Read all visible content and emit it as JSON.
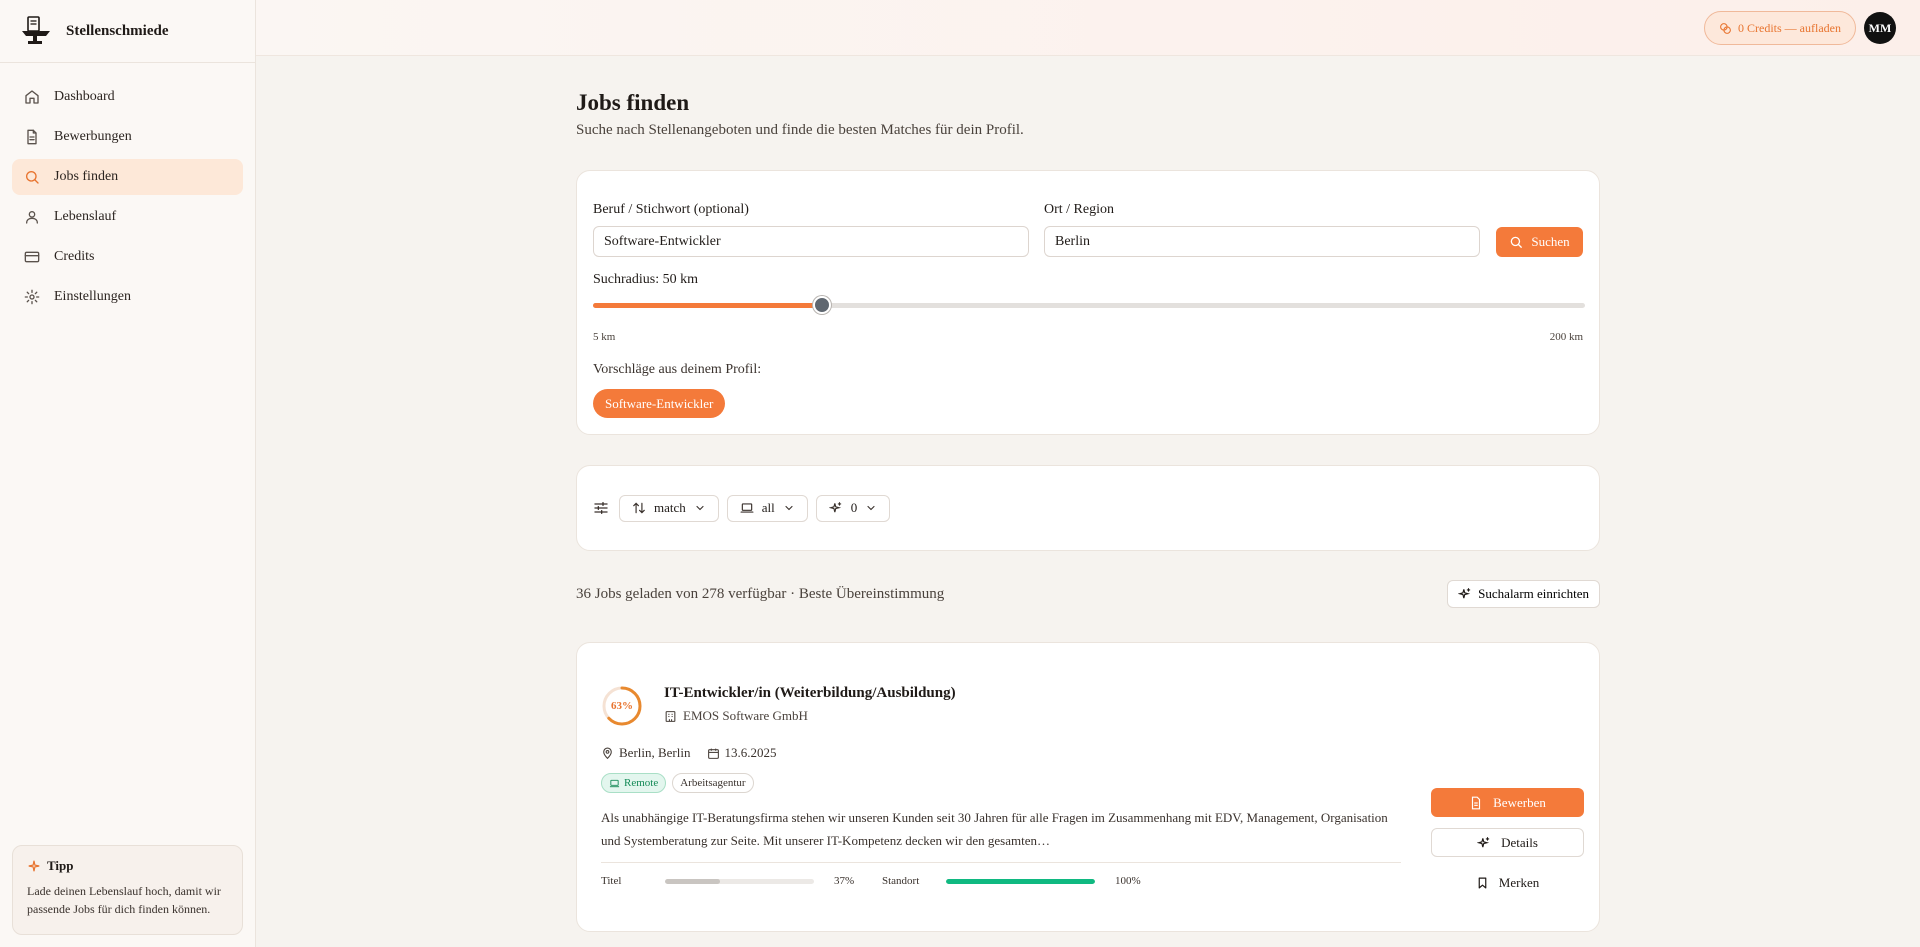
{
  "app": {
    "name": "Stellenschmiede"
  },
  "sidebar": {
    "items": [
      {
        "label": "Dashboard",
        "icon": "home-icon"
      },
      {
        "label": "Bewerbungen",
        "icon": "document-icon"
      },
      {
        "label": "Jobs finden",
        "icon": "search-icon",
        "active": true
      },
      {
        "label": "Lebenslauf",
        "icon": "user-icon"
      },
      {
        "label": "Credits",
        "icon": "credit-card-icon"
      },
      {
        "label": "Einstellungen",
        "icon": "gear-icon"
      }
    ],
    "tip": {
      "title": "Tipp",
      "text": "Lade deinen Lebenslauf hoch, damit wir passende Jobs für dich finden können."
    }
  },
  "topbar": {
    "credits_label": "0 Credits — aufladen",
    "avatar_initials": "MM"
  },
  "page": {
    "title": "Jobs finden",
    "subtitle": "Suche nach Stellenangeboten und finde die besten Matches für dein Profil."
  },
  "search": {
    "keyword_label": "Beruf / Stichwort (optional)",
    "keyword_value": "Software-Entwickler",
    "location_label": "Ort / Region",
    "location_value": "Berlin",
    "button_label": "Suchen",
    "radius_label": "Suchradius: 50 km",
    "radius_value": 50,
    "radius_min": 5,
    "radius_max": 200,
    "radius_min_label": "5 km",
    "radius_max_label": "200 km",
    "suggestions_label": "Vorschläge aus deinem Profil:",
    "suggestions": [
      "Software-Entwickler"
    ]
  },
  "filters": {
    "sort": "match",
    "work_mode": "all",
    "extra": "0"
  },
  "results": {
    "summary": "36 Jobs geladen von 278 verfügbar · Beste Übereinstimmung",
    "alarm_label": "Suchalarm einrichten"
  },
  "colors": {
    "accent": "#f47a3a",
    "success": "#10b981"
  },
  "jobs": [
    {
      "match_pct": 63,
      "match_label": "63%",
      "title": "IT-Entwickler/in (Weiterbildung/Ausbildung)",
      "company": "EMOS Software GmbH",
      "location": "Berlin, Berlin",
      "date": "13.6.2025",
      "tags": [
        "Remote",
        "Arbeitsagentur"
      ],
      "description": "Als unabhängige IT-Beratungsfirma stehen wir unseren Kunden seit 30 Jahren für alle Fragen im Zusammenhang mit EDV, Management, Organisation und Systemberatung zur Seite. Mit unserer IT-Kompetenz decken wir den gesamten…",
      "scores": [
        {
          "label": "Titel",
          "value": 37,
          "value_label": "37%"
        },
        {
          "label": "Standort",
          "value": 100,
          "value_label": "100%"
        }
      ],
      "actions": {
        "apply": "Bewerben",
        "details": "Details",
        "save": "Merken"
      }
    }
  ]
}
